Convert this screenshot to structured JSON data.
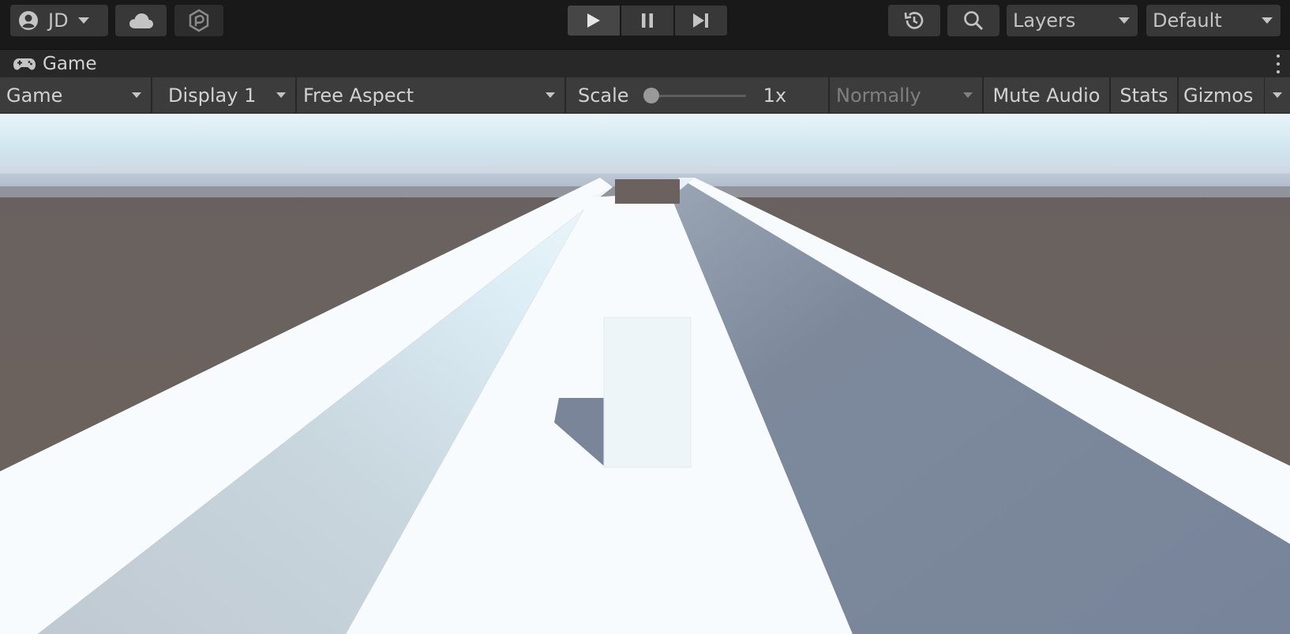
{
  "toolbar": {
    "account": {
      "label": "JD",
      "icon": "account-avatar-icon"
    },
    "cloud": {
      "icon": "cloud-icon"
    },
    "collab": {
      "icon": "package-manager-icon"
    },
    "play": {
      "icon": "play-icon"
    },
    "pause": {
      "icon": "pause-icon"
    },
    "step": {
      "icon": "step-icon"
    },
    "history": {
      "icon": "history-icon"
    },
    "search": {
      "icon": "search-icon"
    },
    "layers": {
      "label": "Layers"
    },
    "layout": {
      "label": "Default"
    }
  },
  "window_tab": {
    "title": "Game",
    "icon": "gamepad-icon"
  },
  "game_controls": {
    "view_mode": "Game",
    "display": "Display 1",
    "aspect": "Free Aspect",
    "scale_label": "Scale",
    "scale_value": "1x",
    "scale_fraction": 0,
    "play_focus": "Normally",
    "mute_audio": "Mute Audio",
    "stats": "Stats",
    "gizmos": "Gizmos"
  },
  "colors": {
    "editor_bg": "#191919",
    "control_bar": "#3c3c3c",
    "ground": "#6a625e",
    "track_top": "#f7fbfd",
    "wall_shadow": "#7c889a",
    "sky_top": "#d4e9f2",
    "horizon": "#a9b7c8"
  }
}
